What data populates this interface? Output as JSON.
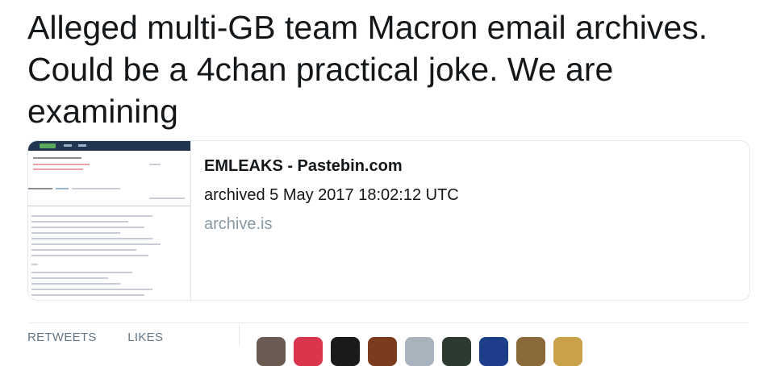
{
  "tweet": {
    "text": "Alleged multi-GB team Macron email archives. Could be a 4chan practical joke. We are examining"
  },
  "card": {
    "title": "EMLEAKS - Pastebin.com",
    "description": "archived 5 May 2017 18:02:12 UTC",
    "domain": "archive.is",
    "thumbnail_icon": "pastebin-page-screenshot"
  },
  "stats": {
    "retweets_label": "RETWEETS",
    "likes_label": "LIKES"
  },
  "avatars": {
    "colors": [
      "#6b5a52",
      "#d9364e",
      "#1a1a1a",
      "#7a3b1f",
      "#a9b3bd",
      "#2d3a2f",
      "#1d3c8a",
      "#8a6a3a",
      "#c9a14a"
    ]
  }
}
